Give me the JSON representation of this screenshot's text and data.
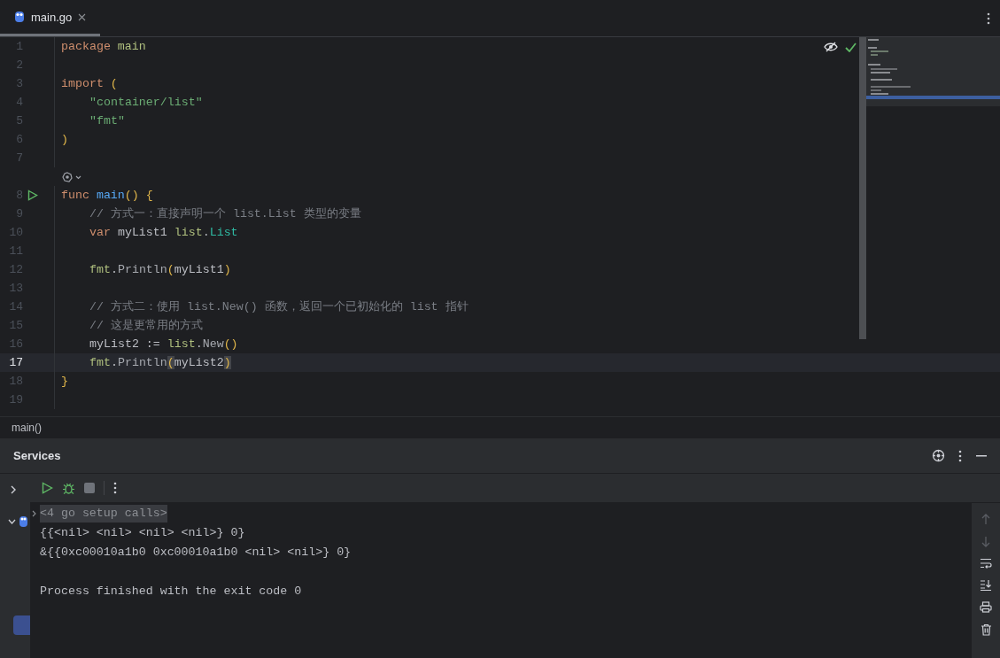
{
  "tabs": [
    {
      "label": "main.go",
      "selected": true
    }
  ],
  "editor": {
    "lines": [
      {
        "number": "1",
        "current": false,
        "tokens": [
          {
            "text": "package ",
            "kind": "keyword"
          },
          {
            "text": "main",
            "kind": "package"
          }
        ]
      },
      {
        "number": "2",
        "current": false
      },
      {
        "number": "3",
        "current": false,
        "tokens": [
          {
            "text": "import ",
            "kind": "keyword"
          },
          {
            "text": "(",
            "kind": "paren"
          }
        ]
      },
      {
        "number": "4",
        "current": false,
        "indented": true,
        "tokens": [
          {
            "text": "\"container/list\"",
            "kind": "string"
          }
        ]
      },
      {
        "number": "5",
        "current": false,
        "indented": true,
        "tokens": [
          {
            "text": "\"fmt\"",
            "kind": "string"
          }
        ]
      },
      {
        "number": "6",
        "current": false,
        "tokens": [
          {
            "text": ")",
            "kind": "paren"
          }
        ]
      },
      {
        "number": "7",
        "current": false
      },
      {
        "number": "8",
        "current": false,
        "run_marker": true,
        "inlay_hint": true,
        "tokens": [
          {
            "text": "func ",
            "kind": "keyword"
          },
          {
            "text": "main",
            "kind": "function"
          },
          {
            "text": "() {",
            "kind": "paren"
          }
        ]
      },
      {
        "number": "9",
        "current": false,
        "indented": true,
        "tokens": [
          {
            "text": "// 方式一：直接声明一个 list.List 类型的变量",
            "kind": "comment"
          }
        ]
      },
      {
        "number": "10",
        "current": false,
        "indented": true,
        "tokens": [
          {
            "text": "var ",
            "kind": "keyword"
          },
          {
            "text": "myList1 "
          },
          {
            "text": "list",
            "kind": "package"
          },
          {
            "text": "."
          },
          {
            "text": "List",
            "kind": "type"
          }
        ]
      },
      {
        "number": "11",
        "current": false
      },
      {
        "number": "12",
        "current": false,
        "indented": true,
        "tokens": [
          {
            "text": "fmt",
            "kind": "package"
          },
          {
            "text": "."
          },
          {
            "text": "Println",
            "kind": "call"
          },
          {
            "text": "(",
            "kind": "paren"
          },
          {
            "text": "myList1"
          },
          {
            "text": ")",
            "kind": "paren"
          }
        ]
      },
      {
        "number": "13",
        "current": false
      },
      {
        "number": "14",
        "current": false,
        "indented": true,
        "tokens": [
          {
            "text": "// 方式二：使用 list.New() 函数，返回一个已初始化的 list 指针",
            "kind": "comment"
          }
        ]
      },
      {
        "number": "15",
        "current": false,
        "indented": true,
        "tokens": [
          {
            "text": "// 这是更常用的方式",
            "kind": "comment"
          }
        ]
      },
      {
        "number": "16",
        "current": false,
        "indented": true,
        "tokens": [
          {
            "text": "myList2 := "
          },
          {
            "text": "list",
            "kind": "package"
          },
          {
            "text": "."
          },
          {
            "text": "New",
            "kind": "call"
          },
          {
            "text": "()",
            "kind": "paren"
          }
        ]
      },
      {
        "number": "17",
        "current": true,
        "indented": true,
        "tokens": [
          {
            "text": "fmt",
            "kind": "package"
          },
          {
            "text": "."
          },
          {
            "text": "Println",
            "kind": "call"
          },
          {
            "text": "(",
            "kind": "paren_match"
          },
          {
            "text": "myList2"
          },
          {
            "text": ")",
            "kind": "paren_match"
          }
        ]
      },
      {
        "number": "18",
        "current": false,
        "tokens": [
          {
            "text": "}",
            "kind": "paren"
          }
        ]
      },
      {
        "number": "19",
        "current": false
      }
    ]
  },
  "breadcrumb": "main()",
  "services": {
    "title": "Services",
    "console": [
      {
        "kind": "folded",
        "text": "<4 go setup calls>"
      },
      {
        "kind": "output",
        "text": "{{<nil> <nil> <nil> <nil>} 0}"
      },
      {
        "kind": "output",
        "text": "&{{0xc00010a1b0 0xc00010a1b0 <nil> <nil>} 0}"
      },
      {
        "kind": "blank"
      },
      {
        "kind": "output",
        "text": "Process finished with the exit code 0"
      }
    ]
  }
}
